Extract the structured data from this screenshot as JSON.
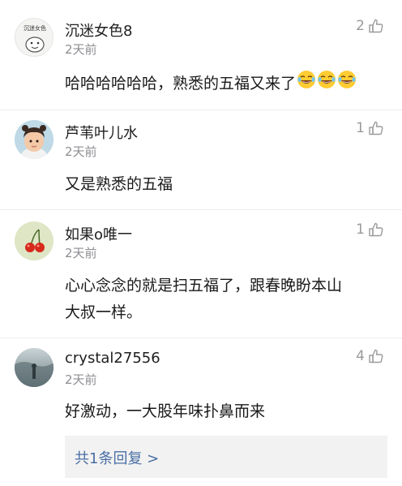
{
  "comments": [
    {
      "username": "沉迷女色8",
      "time": "2天前",
      "likes": "2",
      "text_lines": [
        "哈哈哈哈哈哈，熟悉的五福又来了"
      ],
      "avatar_text": "沉迷女色"
    },
    {
      "username": "芦苇叶儿水",
      "time": "2天前",
      "likes": "1",
      "text_lines": [
        "又是熟悉的五福"
      ]
    },
    {
      "username": "如果o唯一",
      "time": "2天前",
      "likes": "1",
      "text_lines": [
        "心心念念的就是扫五福了，跟春晚盼本山",
        "大叔一样。"
      ]
    },
    {
      "username": "crystal27556",
      "time": "2天前",
      "likes": "4",
      "text_lines": [
        "好激动，一大股年味扑鼻而来"
      ]
    }
  ],
  "reply": {
    "label": "共1条回复 >"
  },
  "colors": {
    "link": "#4a6fa5",
    "muted": "#8e8e93",
    "divider": "#ececec"
  },
  "icons": {
    "like": "thumbs-up-outline-icon",
    "emoji": "tears-of-joy-emoji"
  }
}
